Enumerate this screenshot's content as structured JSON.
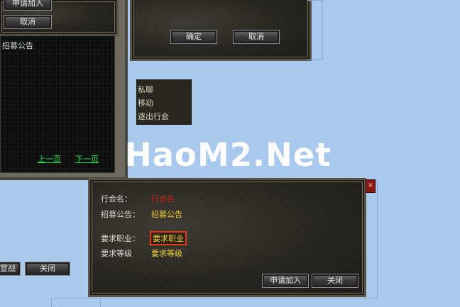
{
  "left_panel": {
    "apply_button": "申请加入",
    "cancel_button": "取消",
    "header": "招募公告",
    "prev_page": "上一页",
    "next_page": "下一页",
    "partial_button": "宣战",
    "close_button": "关闭"
  },
  "top_dialog": {
    "confirm_button": "确定",
    "cancel_button": "取消"
  },
  "context_menu": {
    "items": [
      "私聊",
      "移动",
      "逐出行会"
    ]
  },
  "watermark": "HaoM2.Net",
  "guild_dialog": {
    "guild_name_label": "行会名：",
    "guild_name_value": "行会名",
    "recruit_label": "招募公告：",
    "recruit_value": "招募公告",
    "job_label": "要求职业：",
    "job_value": "要求职业",
    "level_label": "要求等级",
    "level_value": "要求等级",
    "apply_button": "申请加入",
    "close_button": "关闭",
    "close_x": "×"
  },
  "colors": {
    "background": "#a9c9ee",
    "link_green": "#2ce04c",
    "value_yellow": "#f3d23a",
    "value_red": "#d02020"
  }
}
